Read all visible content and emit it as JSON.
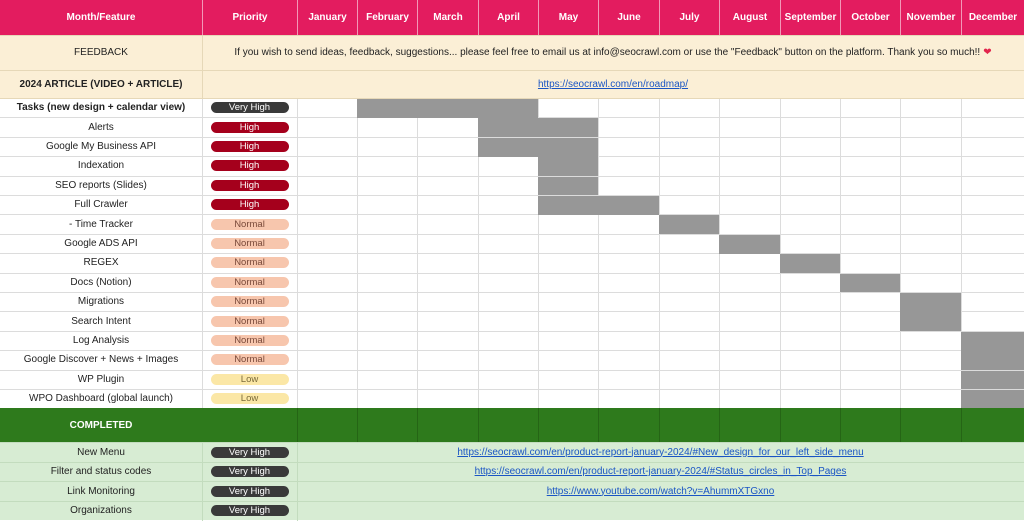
{
  "columns": [
    "Month/Feature",
    "Priority",
    "January",
    "February",
    "March",
    "April",
    "May",
    "June",
    "July",
    "August",
    "September",
    "October",
    "November",
    "December"
  ],
  "feedback": {
    "label": "FEEDBACK",
    "text": "If you wish to send ideas, feedback, suggestions... please feel free to email us at info@seocrawl.com or use the \"Feedback\" button on the platform. Thank you so much!!",
    "heart": "❤"
  },
  "article": {
    "label": "2024 ARTICLE (VIDEO + ARTICLE)",
    "link": "https://seocrawl.com/en/roadmap/"
  },
  "priority_styles": {
    "Very High": {
      "bg": "#3a3a3a",
      "fg": "#ffffff"
    },
    "High": {
      "bg": "#a5001c",
      "fg": "#ffffff"
    },
    "Normal": {
      "bg": "#f7c6ad",
      "fg": "#7a4a3a"
    },
    "Low": {
      "bg": "#fbe7a6",
      "fg": "#7a6a3a"
    }
  },
  "tasks": [
    {
      "name": "Tasks (new design + calendar view)",
      "priority": "Very High",
      "start": 2,
      "end": 4,
      "bold": true
    },
    {
      "name": "Alerts",
      "priority": "High",
      "start": 4,
      "end": 5
    },
    {
      "name": "Google My Business API",
      "priority": "High",
      "start": 4,
      "end": 5
    },
    {
      "name": "Indexation",
      "priority": "High",
      "start": 5,
      "end": 5
    },
    {
      "name": "SEO reports (Slides)",
      "priority": "High",
      "start": 5,
      "end": 5
    },
    {
      "name": "Full Crawler",
      "priority": "High",
      "start": 5,
      "end": 6
    },
    {
      "name": "- Time Tracker",
      "priority": "Normal",
      "start": 7,
      "end": 7
    },
    {
      "name": "Google ADS API",
      "priority": "Normal",
      "start": 8,
      "end": 8
    },
    {
      "name": "REGEX",
      "priority": "Normal",
      "start": 9,
      "end": 9
    },
    {
      "name": "Docs (Notion)",
      "priority": "Normal",
      "start": 10,
      "end": 10
    },
    {
      "name": "Migrations",
      "priority": "Normal",
      "start": 11,
      "end": 11
    },
    {
      "name": "Search Intent",
      "priority": "Normal",
      "start": 11,
      "end": 11
    },
    {
      "name": "Log Analysis",
      "priority": "Normal",
      "start": 12,
      "end": 12
    },
    {
      "name": "Google Discover + News + Images",
      "priority": "Normal",
      "start": 12,
      "end": 12
    },
    {
      "name": "WP Plugin",
      "priority": "Low",
      "start": 12,
      "end": 12
    },
    {
      "name": "WPO Dashboard (global launch)",
      "priority": "Low",
      "start": 12,
      "end": 12
    }
  ],
  "completed": {
    "label": "COMPLETED",
    "items": [
      {
        "name": "New Menu",
        "priority": "Very High",
        "link": "https://seocrawl.com/en/product-report-january-2024/#New_design_for_our_left_side_menu"
      },
      {
        "name": "Filter and status codes",
        "priority": "Very High",
        "link": "https://seocrawl.com/en/product-report-january-2024/#Status_circles_in_Top_Pages"
      },
      {
        "name": "Link Monitoring",
        "priority": "Very High",
        "link": "https://www.youtube.com/watch?v=AhummXTGxno"
      },
      {
        "name": "Organizations",
        "priority": "Very High",
        "link": ""
      }
    ]
  }
}
